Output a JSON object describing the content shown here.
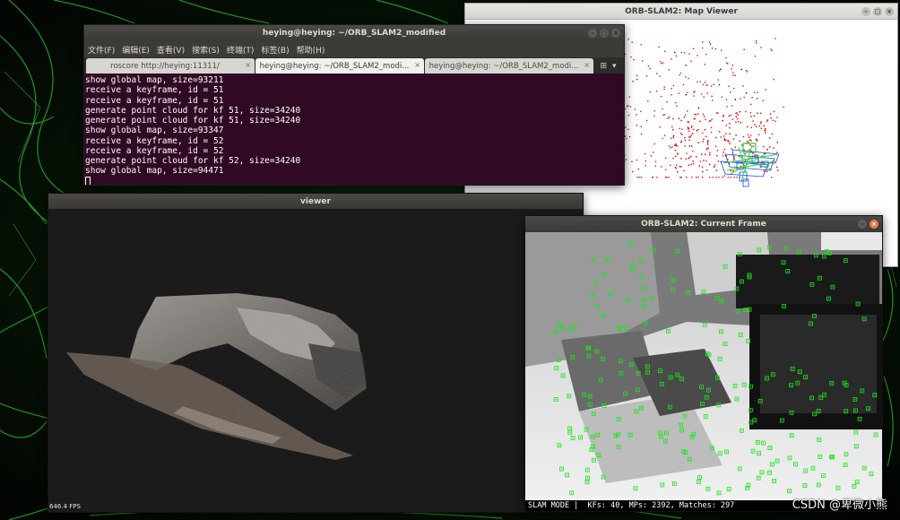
{
  "colors": {
    "terminal_bg": "#300a24",
    "close_button": "#f07746",
    "feature_green": "#19e619",
    "map_points_red": "#e01212",
    "map_keyframes_blue": "#1f3cff"
  },
  "map_viewer": {
    "title": "ORB-SLAM2: Map Viewer"
  },
  "terminal": {
    "title": "heying@heying: ~/ORB_SLAM2_modified",
    "menu": [
      "文件(F)",
      "编辑(E)",
      "查看(V)",
      "搜索(S)",
      "终端(T)",
      "标签(B)",
      "帮助(H)"
    ],
    "tabs": [
      {
        "label": "roscore http://heying:11311/"
      },
      {
        "label": "heying@heying: ~/ORB_SLAM2_modi..."
      },
      {
        "label": "heying@heying: ~/ORB_SLAM2_modi..."
      }
    ],
    "lines": [
      "show global map, size=93211",
      "receive a keyframe, id = 51",
      "receive a keyframe, id = 51",
      "generate point cloud for kf 51, size=34240",
      "generate point cloud for kf 51, size=34240",
      "show global map, size=93347",
      "receive a keyframe, id = 52",
      "receive a keyframe, id = 52",
      "generate point cloud for kf 52, size=34240",
      "show global map, size=94471"
    ]
  },
  "viewer": {
    "title": "viewer",
    "fps": "646.4 FPS"
  },
  "current_frame": {
    "title": "ORB-SLAM2: Current Frame",
    "status": "SLAM MODE |  KFs: 40, MPs: 2392, Matches: 297"
  },
  "watermark": "CSDN @卑微小熊"
}
